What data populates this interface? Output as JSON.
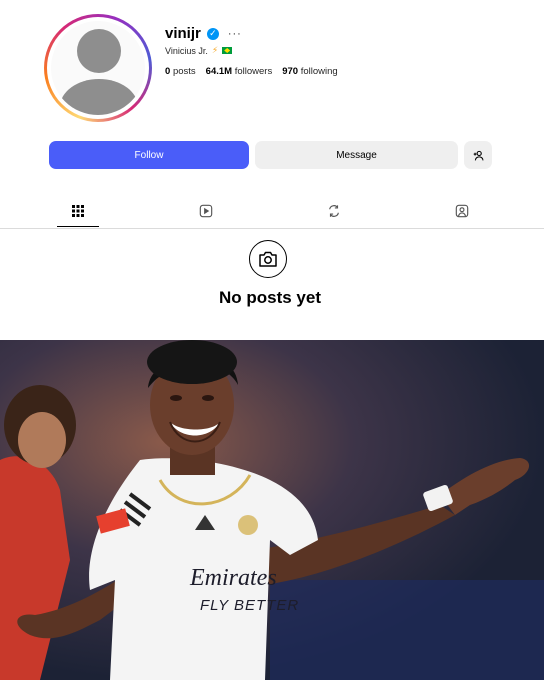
{
  "profile": {
    "username": "vinijr",
    "verified": true,
    "more_label": "···",
    "full_name": "Vinicius Jr.",
    "full_name_emoji": [
      "lightning-bolt",
      "brazil-flag"
    ],
    "stats": {
      "posts_value": "0",
      "posts_label": "posts",
      "followers_value": "64.1M",
      "followers_label": "followers",
      "following_value": "970",
      "following_label": "following"
    }
  },
  "actions": {
    "follow_label": "Follow",
    "message_label": "Message",
    "suggest_icon": "add-person-icon"
  },
  "tabs": [
    {
      "icon": "grid-icon",
      "active": true
    },
    {
      "icon": "reels-icon",
      "active": false
    },
    {
      "icon": "reposts-icon",
      "active": false
    },
    {
      "icon": "tagged-icon",
      "active": false
    }
  ],
  "empty_state": {
    "icon": "camera-icon",
    "title": "No posts yet"
  },
  "photo": {
    "subject": "football-player-photo",
    "shirt_text": [
      "Emirates",
      "FLY BETTER"
    ]
  },
  "colors": {
    "follow_button": "#4a5df9",
    "secondary_button": "#efefef",
    "verified_badge": "#0095f6"
  }
}
